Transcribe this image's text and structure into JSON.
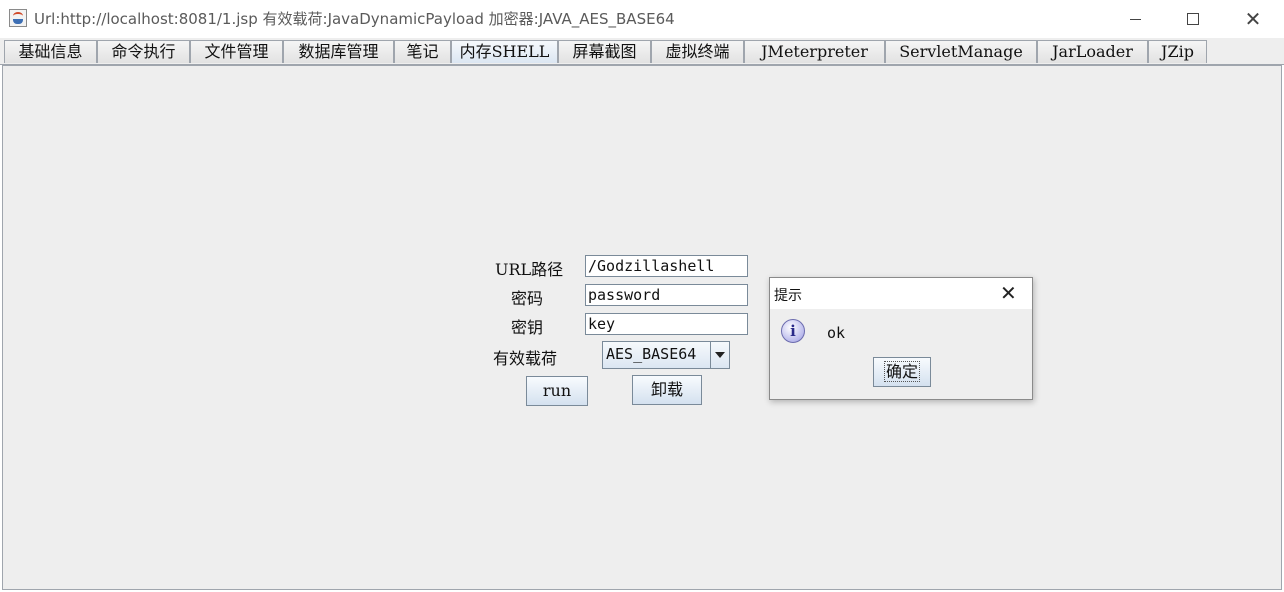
{
  "window": {
    "title": "Url:http://localhost:8081/1.jsp 有效载荷:JavaDynamicPayload 加密器:JAVA_AES_BASE64",
    "icon": "java-cup-icon",
    "controls": {
      "minimize": "minimize-icon",
      "maximize": "maximize-icon",
      "close": "✕"
    }
  },
  "tabs": [
    {
      "label": "基础信息",
      "active": false
    },
    {
      "label": "命令执行",
      "active": false
    },
    {
      "label": "文件管理",
      "active": false
    },
    {
      "label": "数据库管理",
      "active": false
    },
    {
      "label": "笔记",
      "active": false
    },
    {
      "label": "内存SHELL",
      "active": true
    },
    {
      "label": "屏幕截图",
      "active": false
    },
    {
      "label": "虚拟终端",
      "active": false
    },
    {
      "label": "JMeterpreter",
      "active": false
    },
    {
      "label": "ServletManage",
      "active": false
    },
    {
      "label": "JarLoader",
      "active": false
    },
    {
      "label": "JZip",
      "active": false
    }
  ],
  "form": {
    "url_label": "URL路径",
    "url_value": "/Godzillashell",
    "password_label": "密码",
    "password_value": "password",
    "key_label": "密钥",
    "key_value": "key",
    "payload_label": "有效载荷",
    "payload_value": "AES_BASE64",
    "run_label": "run",
    "uninstall_label": "卸载"
  },
  "dialog": {
    "title": "提示",
    "close": "✕",
    "icon": "info-icon",
    "icon_glyph": "i",
    "message": "ok",
    "ok_label": "确定"
  },
  "colors": {
    "panel_bg": "#eeeeee",
    "border": "#9fa5ad",
    "active_tab": "#dbe6f2"
  }
}
